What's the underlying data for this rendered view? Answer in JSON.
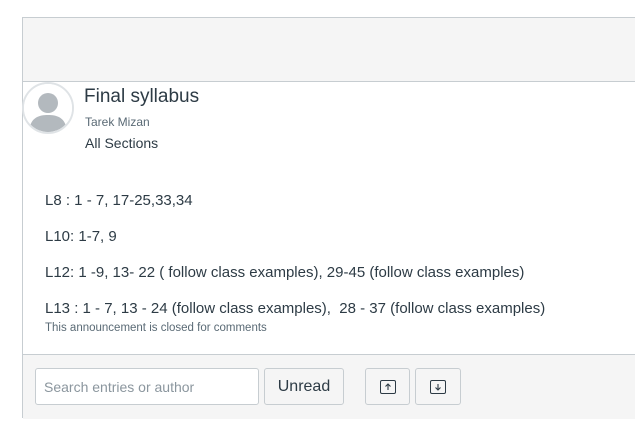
{
  "announcement": {
    "title": "Final syllabus",
    "author": "Tarek Mizan",
    "sections": "All Sections",
    "lines": [
      "L8 : 1 - 7, 17-25,33,34",
      "L10: 1-7, 9",
      "L12: 1 -9, 13- 22 ( follow class examples), 29-45 (follow class examples)",
      "L13 : 1 - 7, 13 - 24 (follow class examples),  28 - 37 (follow class examples)"
    ],
    "closed_note": "This announcement is closed for comments"
  },
  "toolbar": {
    "search_placeholder": "Search entries or author",
    "unread_label": "Unread",
    "expand_icon": "arrow-up-box-icon",
    "collapse_icon": "arrow-down-box-icon"
  },
  "colors": {
    "text": "#2d3b45",
    "muted": "#5a6a75",
    "border": "#c7cdd1",
    "band": "#f5f5f5"
  }
}
